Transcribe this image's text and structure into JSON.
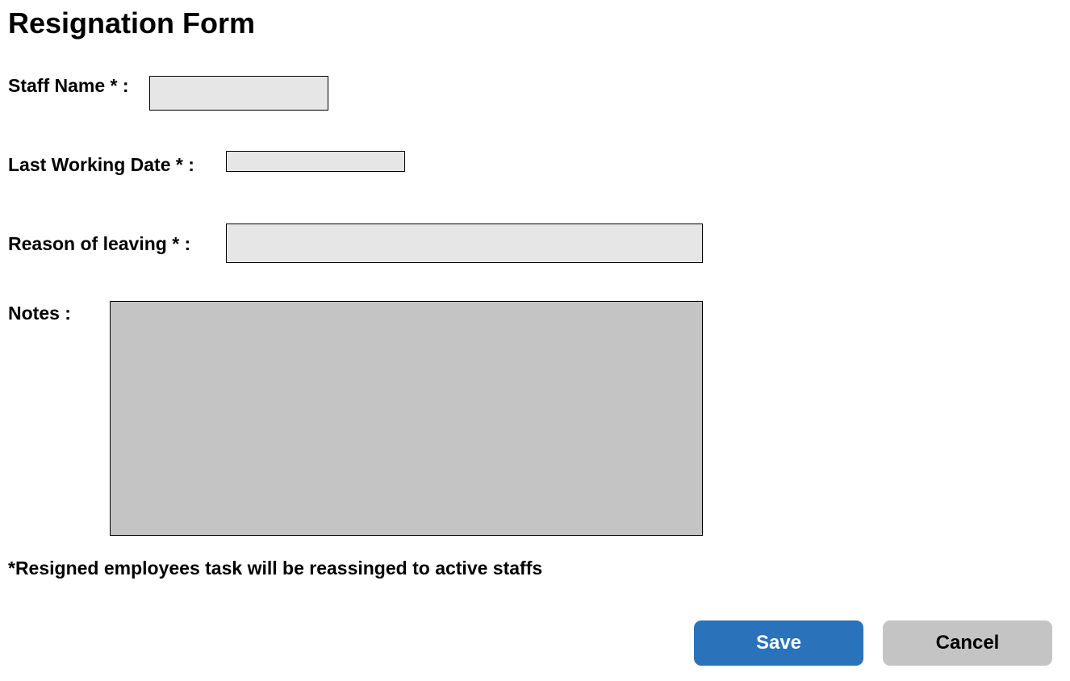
{
  "form": {
    "title": "Resignation Form",
    "staff_name": {
      "label": "Staff Name * :",
      "value": ""
    },
    "last_working_date": {
      "label": "Last Working Date * :",
      "value": ""
    },
    "reason_of_leaving": {
      "label": "Reason of leaving * :",
      "value": ""
    },
    "notes": {
      "label": "Notes  :",
      "value": ""
    },
    "footnote": "*Resigned employees task will be reassinged to active staffs"
  },
  "actions": {
    "save_label": "Save",
    "cancel_label": "Cancel"
  },
  "colors": {
    "save_button": "#2a72b9",
    "cancel_button": "#c4c4c4",
    "input_background": "#e6e6e6",
    "notes_background": "#c4c4c4"
  }
}
